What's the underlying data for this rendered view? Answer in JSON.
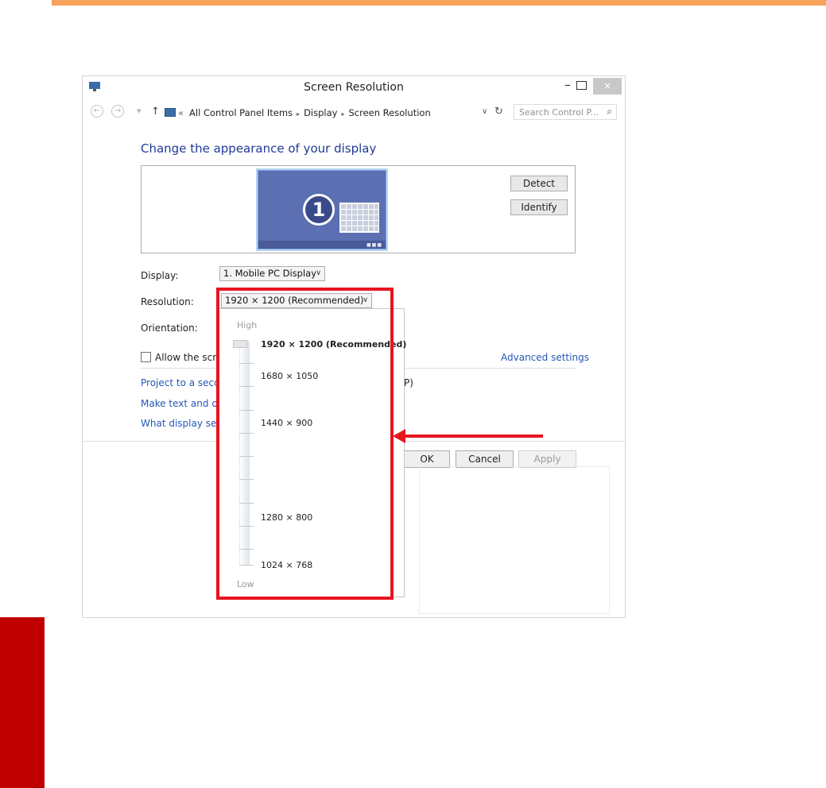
{
  "window": {
    "title": "Screen Resolution",
    "minimize": "–",
    "close": "×"
  },
  "address_bar": {
    "back": "←",
    "forward": "→",
    "dropdown": "▼",
    "up": "↑",
    "overflow": "«",
    "crumbs": [
      "All Control Panel Items",
      "Display",
      "Screen Resolution"
    ],
    "crumb_separator": "▸",
    "combo_arrow": "∨",
    "refresh": "↻",
    "search_placeholder": "Search Control P...",
    "search_icon": "⌕"
  },
  "main": {
    "heading": "Change the appearance of your display",
    "monitor_number": "1",
    "detect": "Detect",
    "identify": "Identify",
    "display_label": "Display:",
    "display_value": "1. Mobile PC Display",
    "resolution_label": "Resolution:",
    "resolution_value": "1920 × 1200 (Recommended)",
    "orientation_label": "Orientation:",
    "checkbox_label": "Allow the screen",
    "advanced": "Advanced settings",
    "links": [
      "Project to a second",
      "Make text and othe",
      "What display settin"
    ],
    "hidden_suffix": "P)",
    "chevron": "∨"
  },
  "footer": {
    "ok": "OK",
    "cancel": "Cancel",
    "apply": "Apply"
  },
  "resolution_dropdown": {
    "high": "High",
    "low": "Low",
    "options": [
      "1920 × 1200 (Recommended)",
      "1680 × 1050",
      "1440 × 900",
      "1280 × 800",
      "1024 × 768"
    ],
    "selected_index": 0
  },
  "colors": {
    "accent_orange": "#f7a35c",
    "side_tab_red": "#c00000",
    "highlight_red": "#e8141f",
    "heading_blue": "#1f3a99",
    "link_blue": "#2458b8"
  }
}
